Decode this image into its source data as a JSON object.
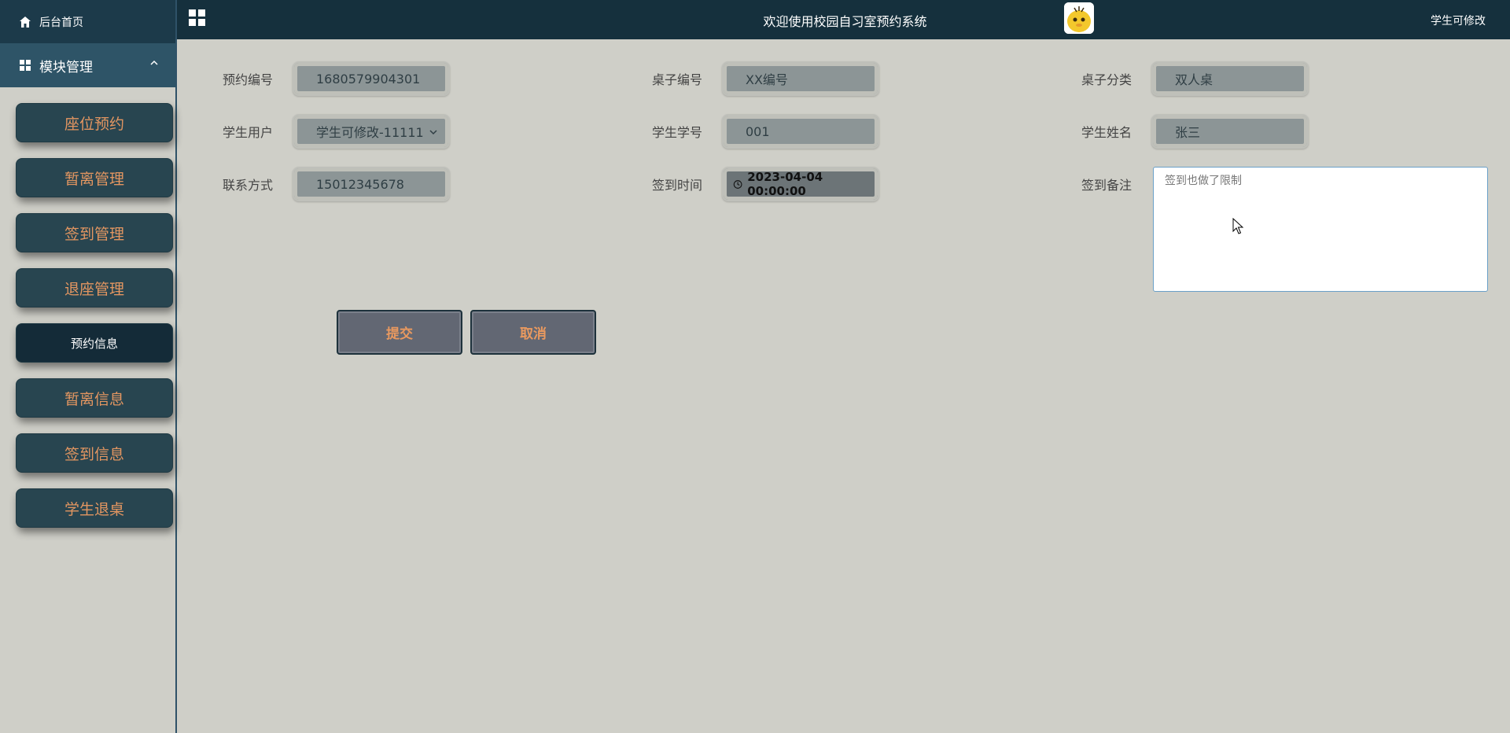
{
  "sidebar": {
    "home_label": "后台首页",
    "module_label": "模块管理",
    "items": [
      {
        "label": "座位预约"
      },
      {
        "label": "暂离管理"
      },
      {
        "label": "签到管理"
      },
      {
        "label": "退座管理"
      },
      {
        "label": "预约信息"
      },
      {
        "label": "暂离信息"
      },
      {
        "label": "签到信息"
      },
      {
        "label": "学生退桌"
      }
    ]
  },
  "header": {
    "title": "欢迎使用校园自习室预约系统",
    "user_name": "学生可修改"
  },
  "form": {
    "reservation_no_label": "预约编号",
    "reservation_no": "1680579904301",
    "desk_no_label": "桌子编号",
    "desk_no": "XX编号",
    "desk_category_label": "桌子分类",
    "desk_category": "双人桌",
    "student_user_label": "学生用户",
    "student_user": "学生可修改-11111",
    "student_id_label": "学生学号",
    "student_id": "001",
    "student_name_label": "学生姓名",
    "student_name": "张三",
    "contact_label": "联系方式",
    "contact": "15012345678",
    "checkin_time_label": "签到时间",
    "checkin_time": "2023-04-04 00:00:00",
    "checkin_note_label": "签到备注",
    "checkin_note": "签到也做了限制",
    "submit_label": "提交",
    "cancel_label": "取消"
  }
}
